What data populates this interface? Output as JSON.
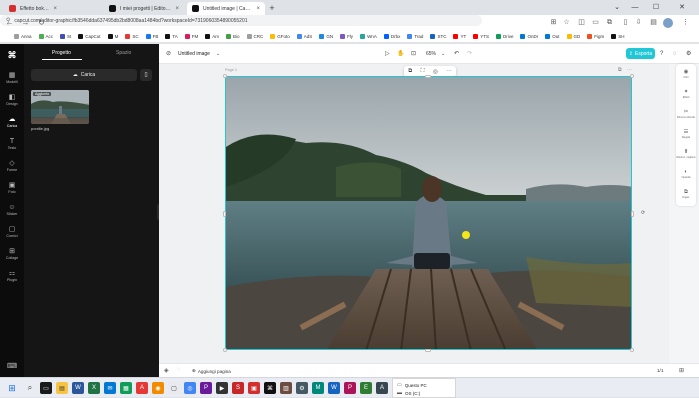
{
  "browser": {
    "tabs": [
      {
        "title": "Effetto bokeh: cos'è e come si...",
        "active": false,
        "favicon_color": "#d32f2f"
      },
      {
        "title": "I miei progetti | Editor onli...",
        "active": false,
        "favicon_color": "#111111"
      },
      {
        "title": "Untitled image | CapCut",
        "active": true,
        "favicon_color": "#111111"
      }
    ],
    "new_tab": "+",
    "window_controls": [
      "⌄",
      "—",
      "☐",
      "✕"
    ],
    "url": "capcut.com/editor-graphic/fb3546dda637495db2bd8008aa1484bd?workspaceId=7319060354890055201",
    "nav": {
      "back": "←",
      "forward": "→",
      "reload": "↻"
    },
    "bookmarks": [
      {
        "label": "Anna",
        "color": "#9e9e9e"
      },
      {
        "label": "Acc",
        "color": "#4caf50"
      },
      {
        "label": "St",
        "color": "#3f51b5"
      },
      {
        "label": "CapCut",
        "color": "#111111"
      },
      {
        "label": "M",
        "color": "#111111"
      },
      {
        "label": "SC",
        "color": "#e53935"
      },
      {
        "label": "FB",
        "color": "#1877f2"
      },
      {
        "label": "TA",
        "color": "#111111"
      },
      {
        "label": "FM",
        "color": "#d81b60"
      },
      {
        "label": "Am",
        "color": "#111111"
      },
      {
        "label": "Bio",
        "color": "#43a047"
      },
      {
        "label": "CRC",
        "color": "#9e9e9e"
      },
      {
        "label": "GFoto",
        "color": "#fbbc05"
      },
      {
        "label": "AdS",
        "color": "#4285f4"
      },
      {
        "label": "GN",
        "color": "#1e88e5"
      },
      {
        "label": "Fly",
        "color": "#7e57c2"
      },
      {
        "label": "WnA",
        "color": "#26a69a"
      },
      {
        "label": "Drbx",
        "color": "#0061ff"
      },
      {
        "label": "Trad",
        "color": "#4285f4"
      },
      {
        "label": "STC",
        "color": "#1565c0"
      },
      {
        "label": "YT",
        "color": "#ff0000"
      },
      {
        "label": "YTS",
        "color": "#ff0000"
      },
      {
        "label": "Drive",
        "color": "#0f9d58"
      },
      {
        "label": "OnDr",
        "color": "#0078d4"
      },
      {
        "label": "Out",
        "color": "#0078d4"
      },
      {
        "label": "GD",
        "color": "#fbbc05"
      },
      {
        "label": "Figm",
        "color": "#f24e1e"
      },
      {
        "label": "SH",
        "color": "#111111"
      }
    ]
  },
  "rail": {
    "items": [
      {
        "label": "Modelli",
        "icon": "template-icon",
        "glyph": "▦",
        "active": false
      },
      {
        "label": "Design",
        "icon": "design-icon",
        "glyph": "◧",
        "active": false
      },
      {
        "label": "Carica",
        "icon": "upload-cloud-icon",
        "glyph": "☁",
        "active": true
      },
      {
        "label": "Testo",
        "icon": "text-icon",
        "glyph": "T",
        "active": false
      },
      {
        "label": "Forme",
        "icon": "shapes-icon",
        "glyph": "◇",
        "active": false
      },
      {
        "label": "Foto",
        "icon": "photo-icon",
        "glyph": "▣",
        "active": false
      },
      {
        "label": "Sticker",
        "icon": "sticker-icon",
        "glyph": "☺",
        "active": false
      },
      {
        "label": "Cornici",
        "icon": "frame-icon",
        "glyph": "▢",
        "active": false
      },
      {
        "label": "Collage",
        "icon": "collage-icon",
        "glyph": "⊞",
        "active": false
      },
      {
        "label": "Plugin",
        "icon": "plugin-icon",
        "glyph": "⚏",
        "active": false
      }
    ],
    "bottom_icon": "⌨"
  },
  "panel": {
    "tabs": [
      {
        "label": "Progetto",
        "active": true
      },
      {
        "label": "Spazio",
        "active": false
      }
    ],
    "upload_label": "Carica",
    "upload_glyph": "☁",
    "phone_glyph": "▯",
    "asset": {
      "badge": "Aggiunto",
      "filename": "pontile.jpg"
    }
  },
  "editor": {
    "doc_title": "Untitled image",
    "zoom": "65%",
    "export_label": "Esporta",
    "page_label": "Page 1",
    "floatbar_icons": [
      "⧉",
      "⛶",
      "◎",
      "⋯"
    ],
    "add_page_label": "Aggiungi pagina",
    "page_count": "1/1"
  },
  "right_tools": [
    {
      "label": "Filtri",
      "glyph": "◉"
    },
    {
      "label": "Effetti",
      "glyph": "✦"
    },
    {
      "label": "Rimuovi sfondo",
      "glyph": "✂"
    },
    {
      "label": "Regola",
      "glyph": "☰"
    },
    {
      "label": "Risoluz. migliore",
      "glyph": "⬆"
    },
    {
      "label": "Opacità",
      "glyph": "◐"
    },
    {
      "label": "Organ.",
      "glyph": "⧉"
    }
  ],
  "taskbar": {
    "explorer_items": [
      "Questo PC",
      "OS (C:)"
    ]
  }
}
